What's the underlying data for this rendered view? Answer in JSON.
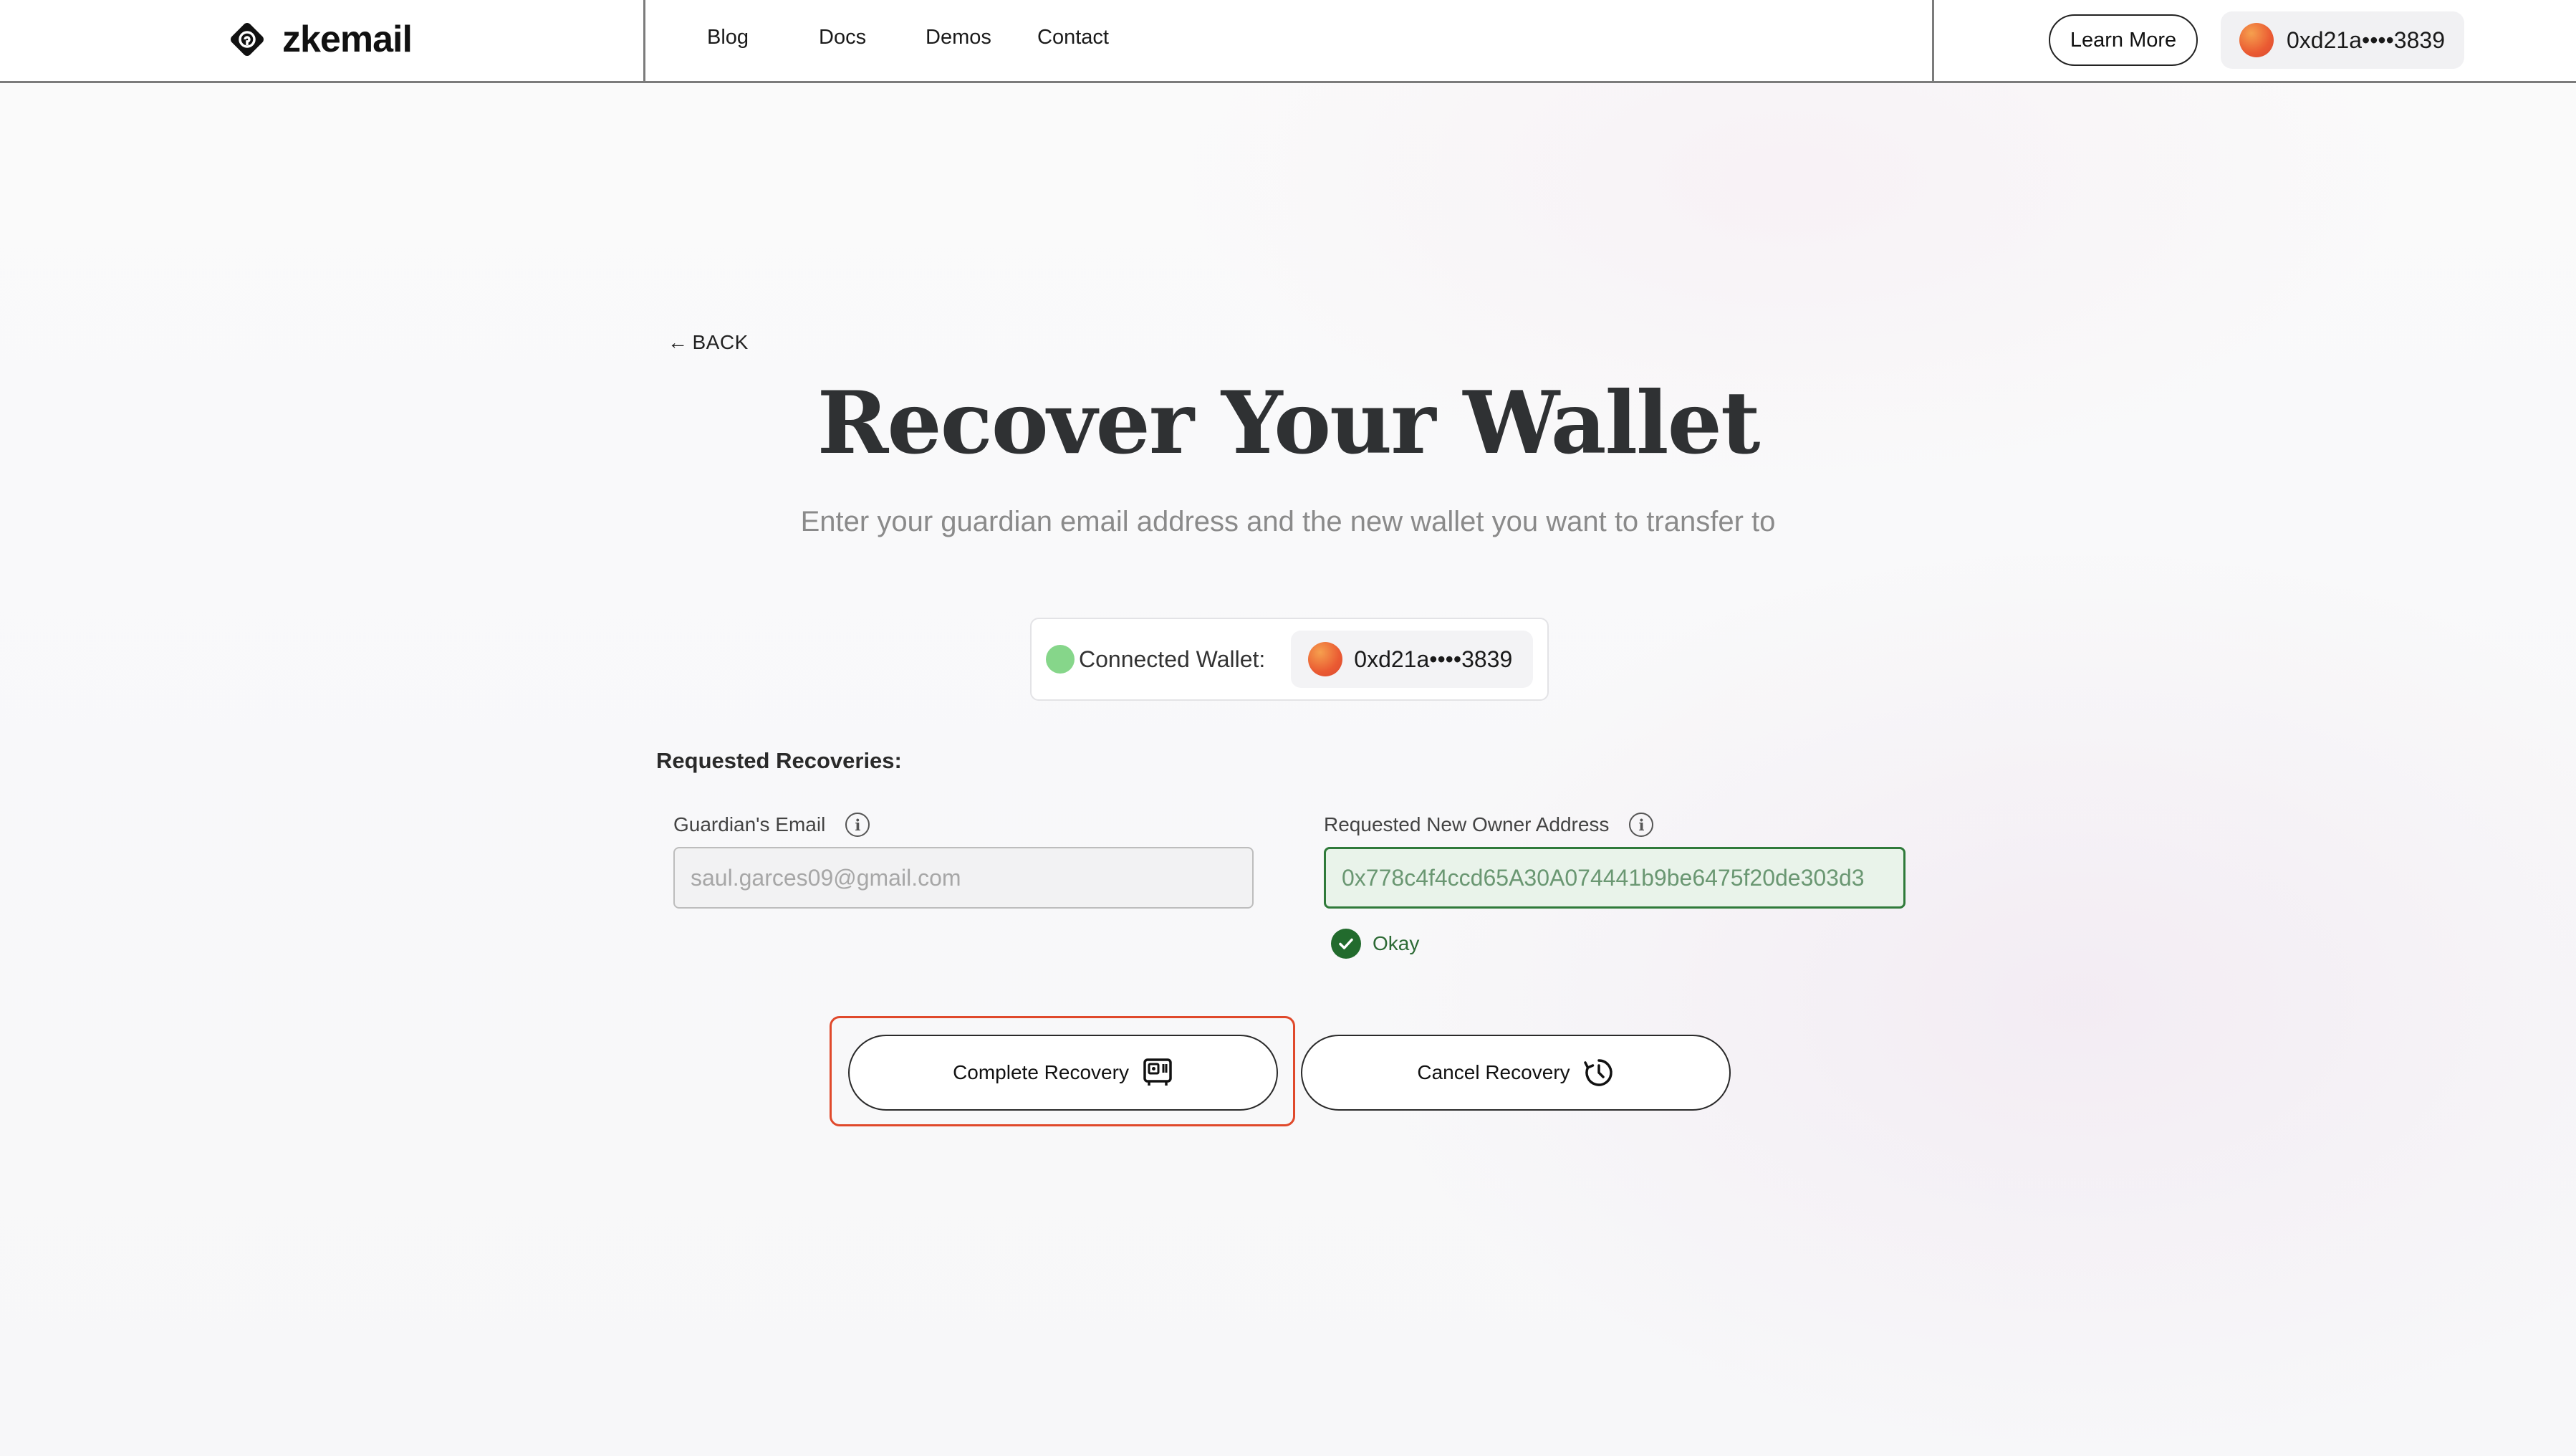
{
  "brand": {
    "name": "zkemail"
  },
  "nav": {
    "links": [
      "Blog",
      "Docs",
      "Demos",
      "Contact"
    ],
    "learn_more": "Learn More",
    "wallet_address": "0xd21a••••3839"
  },
  "page": {
    "back_label": "BACK",
    "title": "Recover Your Wallet",
    "subtitle": "Enter your guardian email address and the new wallet you want to transfer to",
    "connected_label": "Connected Wallet:",
    "connected_address": "0xd21a••••3839",
    "section_label": "Requested Recoveries:"
  },
  "form": {
    "email_label": "Guardian's Email",
    "email_value": "saul.garces09@gmail.com",
    "address_label": "Requested New Owner Address",
    "address_value": "0x778c4f4ccd65A30A074441b9be6475f20de303d3",
    "validation": "Okay"
  },
  "actions": {
    "complete": "Complete Recovery",
    "cancel": "Cancel Recovery"
  },
  "colors": {
    "accent_red": "#e0492b",
    "success_green": "#226b2d",
    "connected_dot": "#86d68a"
  }
}
